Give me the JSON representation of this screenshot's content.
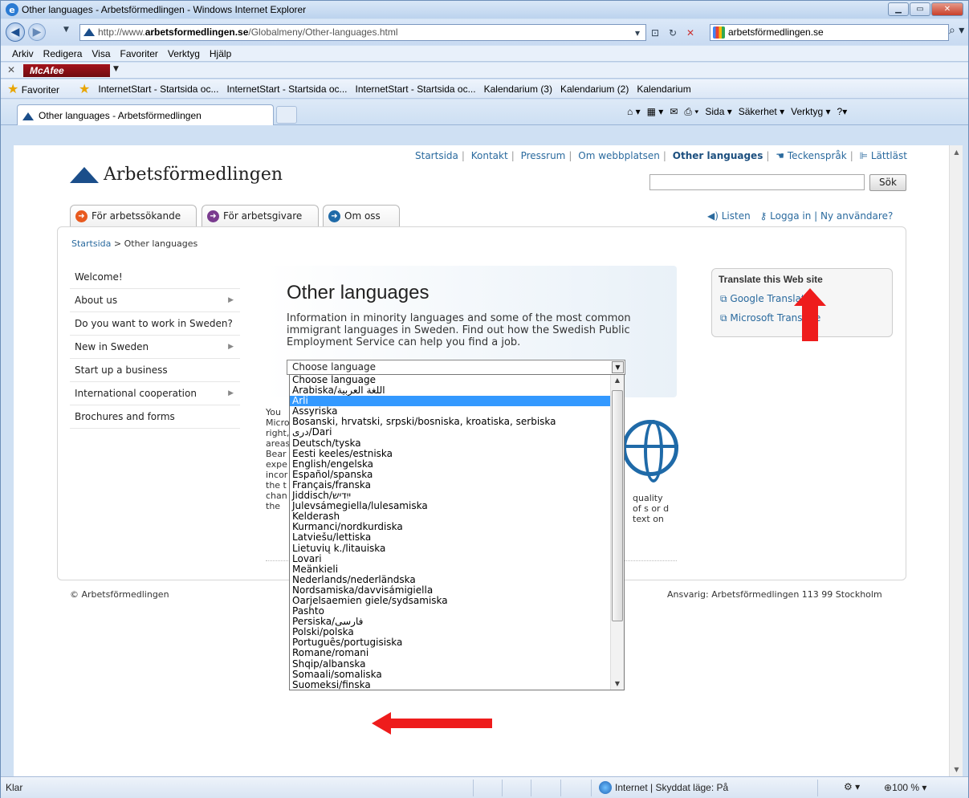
{
  "browser": {
    "window_title": "Other languages - Arbetsförmedlingen - Windows Internet Explorer",
    "url_prefix": "http://www.",
    "url_domain": "arbetsformedlingen.se",
    "url_path": "/Globalmeny/Other-languages.html",
    "search_provider": "arbetsförmedlingen.se",
    "menu": [
      "Arkiv",
      "Redigera",
      "Visa",
      "Favoriter",
      "Verktyg",
      "Hjälp"
    ],
    "mcafee_label": "McAfee",
    "favorites_label": "Favoriter",
    "favorites": [
      "InternetStart - Startsida oc...",
      "InternetStart - Startsida oc...",
      "InternetStart - Startsida oc...",
      "Kalendarium (3)",
      "Kalendarium (2)",
      "Kalendarium"
    ],
    "tab_title": "Other languages - Arbetsförmedlingen",
    "commands": [
      "Sida ▾",
      "Säkerhet ▾",
      "Verktyg ▾"
    ],
    "status_left": "Klar",
    "status_zone": "Internet | Skyddat läge: På",
    "zoom": "100 %"
  },
  "site": {
    "logo_text": "Arbetsförmedlingen",
    "topnav": [
      "Startsida",
      "Kontakt",
      "Pressrum",
      "Om webbplatsen",
      "Other languages",
      "Teckenspråk",
      "Lättläst"
    ],
    "search_button": "Sök",
    "tabs": [
      "För arbetssökande",
      "För arbetsgivare",
      "Om oss"
    ],
    "listen": "Listen",
    "login": "Logga in",
    "new_user": "Ny användare?",
    "breadcrumb_home": "Startsida",
    "breadcrumb_current": "Other languages",
    "leftnav": [
      "Welcome!",
      "About us",
      "Do you want to work in Sweden?",
      "New in Sweden",
      "Start up a business",
      "International cooperation",
      "Brochures and forms"
    ],
    "heading": "Other languages",
    "intro": "Information in minority languages and some of the most common immigrant languages in Sweden. Find out how the Swedish Public Employment Service can help you find a job.",
    "select_value": "Choose language",
    "hidden_text": "You Micro right, areas Bear expe incor the t chan the W",
    "hidden_text_right": "quality of s or d text on",
    "translate_header": "Translate this Web site",
    "translate_links": [
      "Google Translate",
      "Microsoft Translate"
    ],
    "footer_left": "© Arbetsförmedlingen",
    "footer_right": "Ansvarig: Arbetsförmedlingen 113 99 Stockholm"
  },
  "dropdown": {
    "selected_index": 2,
    "options": [
      "Choose language",
      "Arabiska/اللغة العربية",
      "Arli",
      "Assyriska",
      "Bosanski, hrvatski, srpski/bosniska, kroatiska, serbiska",
      "دری/Dari",
      "Deutsch/tyska",
      "Eesti keeles/estniska",
      "English/engelska",
      "Español/spanska",
      "Français/franska",
      "Jiddisch/ייִדיש",
      "Julevsámegiella/lulesamiska",
      "Kelderash",
      "Kurmanci/nordkurdiska",
      "Latviešu/lettiska",
      "Lietuvių k./litauiska",
      "Lovari",
      "Meänkieli",
      "Nederlands/nederländska",
      "Nordsamiska/davvisámigiella",
      "Oarjelsaemien giele/sydsamiska",
      "Pashto",
      "Persiska/فارسی",
      "Polski/polska",
      "Português/portugisiska",
      "Romane/romani",
      "Shqip/albanska",
      "Somaali/somaliska",
      "Suomeksi/finska"
    ]
  }
}
